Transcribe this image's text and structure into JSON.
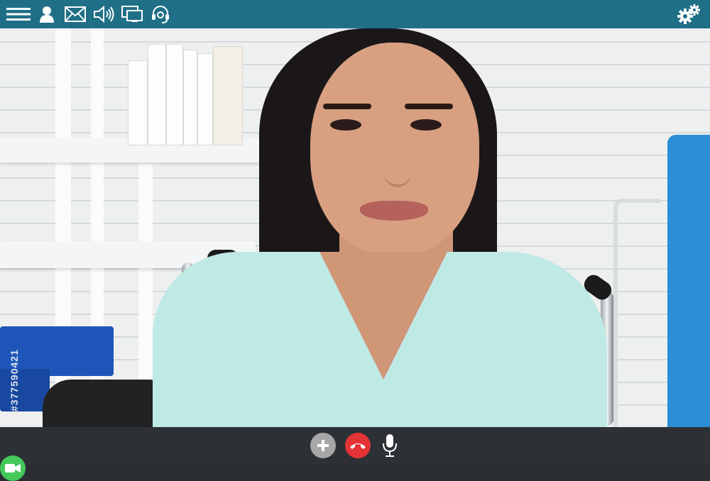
{
  "toolbar": {
    "icons": [
      "menu-icon",
      "user-icon",
      "mail-icon",
      "speaker-icon",
      "screen-share-icon",
      "headset-icon",
      "settings-icon"
    ]
  },
  "video": {
    "watermark": "#377590421"
  },
  "call_controls": {
    "add_participant": "add-icon",
    "camera": "video-camera-icon",
    "hang_up": "phone-hangup-icon",
    "microphone": "microphone-icon"
  },
  "colors": {
    "toolbar_bg": "#1f6f87",
    "controls_bg": "#2d3135",
    "camera_button": "#44c95a",
    "hangup_button": "#e53436",
    "add_button": "#a7a7a7"
  }
}
